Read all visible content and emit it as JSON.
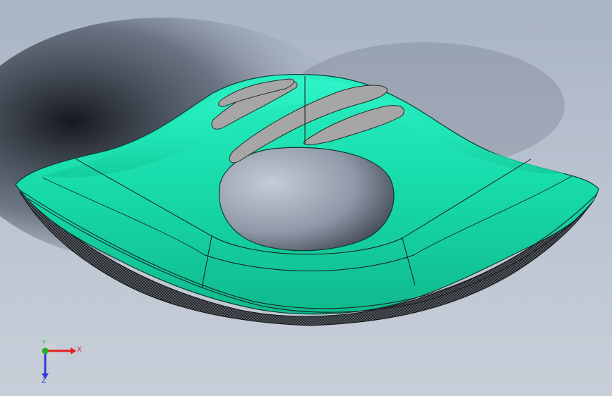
{
  "viewport": {
    "background_top": "#a9b4c4",
    "background_bottom": "#c8cfd9",
    "model": {
      "body_color": "#1de9b6",
      "vent_color": "#a6a6a6",
      "grille_color": "#1c1c1c"
    }
  },
  "triad": {
    "x_label": "X",
    "y_label": "Y",
    "z_label": "Z",
    "x_color": "#e32020",
    "y_color": "#21b021",
    "z_color": "#2f3bd9"
  }
}
